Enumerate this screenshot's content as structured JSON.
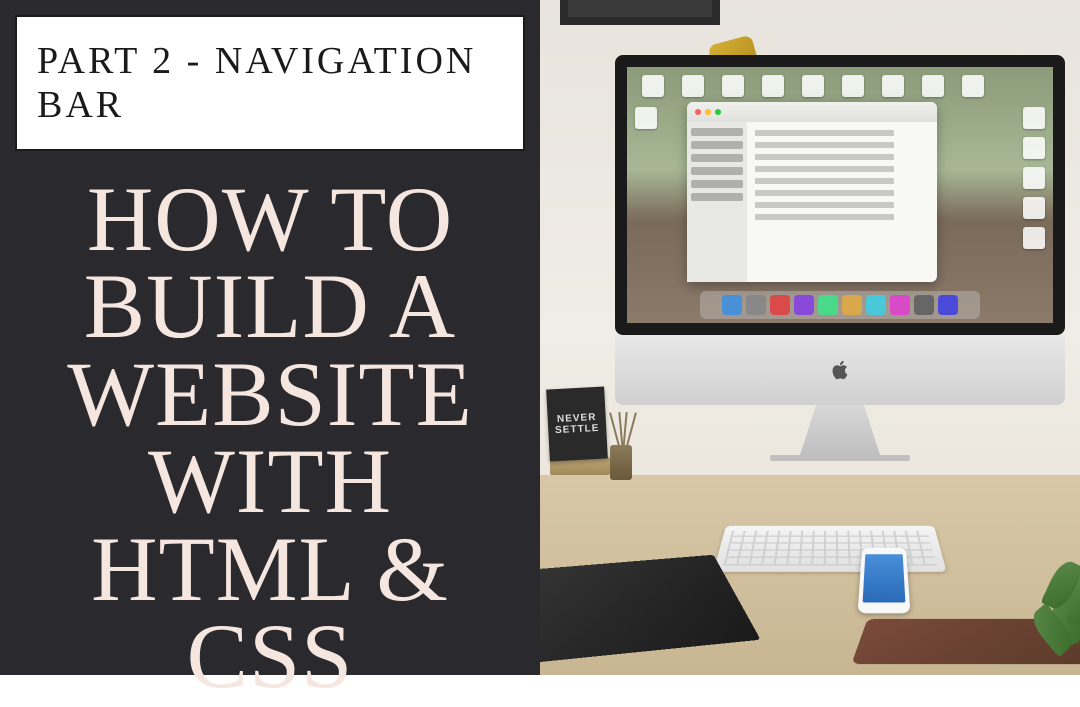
{
  "subtitle": "PART 2 - NAVIGATION BAR",
  "title": "HOW TO BUILD A WEBSITE WITH HTML & CSS",
  "poster": {
    "line1": "NEVER",
    "line2": "SETTLE"
  }
}
